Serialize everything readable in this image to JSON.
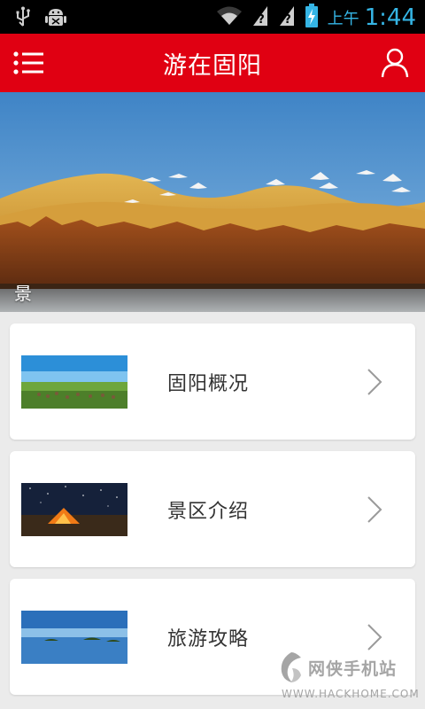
{
  "status_bar": {
    "ampm": "上午",
    "time": "1:44",
    "icons": [
      "usb-icon",
      "android-debug-icon",
      "wifi-icon",
      "no-signal-icon",
      "no-signal-icon",
      "battery-charging-icon"
    ]
  },
  "app_bar": {
    "title": "游在固阳",
    "menu_icon": "menu-icon",
    "user_icon": "user-icon"
  },
  "banner": {
    "caption": "景"
  },
  "menu_cards": [
    {
      "label": "固阳概况",
      "thumbnail": "grassland-thumbnail",
      "icon": "chevron-right-icon"
    },
    {
      "label": "景区介绍",
      "thumbnail": "tent-night-thumbnail",
      "icon": "chevron-right-icon"
    },
    {
      "label": "旅游攻略",
      "thumbnail": "lake-thumbnail",
      "icon": "chevron-right-icon"
    }
  ],
  "watermark": {
    "name": "网侠手机站",
    "url": "WWW.HACKHOME.COM"
  },
  "colors": {
    "app_bar": "#e00012",
    "status_time": "#35b5e5",
    "background": "#ebebeb"
  }
}
